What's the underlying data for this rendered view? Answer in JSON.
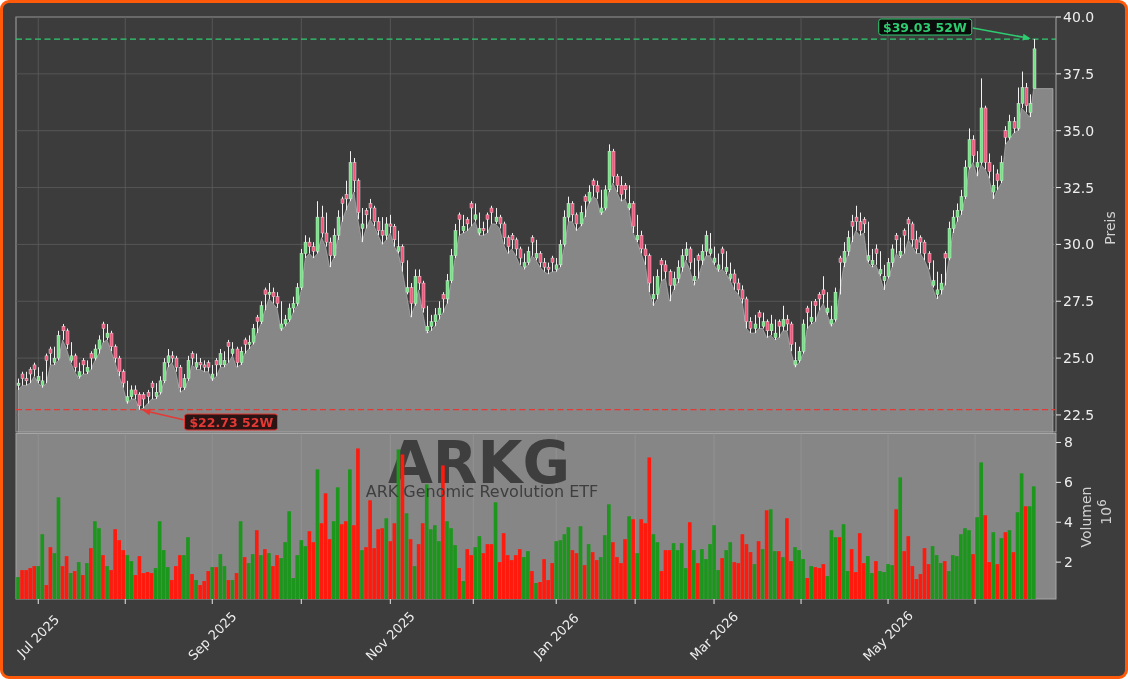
{
  "price_chart": {
    "chart_data": {
      "type": "candlestick",
      "ylabel": "Preis",
      "grid": true,
      "ylim": [
        21.75,
        40.0
      ],
      "yticks": [
        22.5,
        {
          "value": 25,
          "label": "25.0"
        },
        27.5,
        {
          "value": 30,
          "label": "30.0"
        },
        32.5,
        {
          "value": 35,
          "label": "35.0"
        },
        37.5,
        {
          "value": 40,
          "label": "40.0"
        }
      ],
      "categories": [
        null,
        null,
        null,
        null,
        null,
        null,
        null,
        null,
        null,
        null,
        null,
        null,
        null,
        null,
        null,
        null,
        null,
        null,
        null,
        null,
        null,
        null,
        null,
        null,
        null,
        null,
        null,
        null,
        null,
        null,
        null,
        null,
        null,
        null,
        null,
        null,
        null,
        null,
        null,
        null,
        null,
        null,
        null,
        null,
        null,
        null,
        null,
        null,
        null,
        null,
        null,
        null,
        null,
        null,
        null,
        null,
        null,
        null,
        null,
        null,
        null,
        null,
        null,
        null,
        null,
        null,
        null,
        null,
        null,
        null,
        null,
        null,
        null,
        null,
        null,
        null,
        null,
        null,
        null,
        null,
        null,
        null,
        null,
        null,
        null,
        null,
        null,
        null,
        null,
        null,
        null,
        null,
        null,
        null,
        null,
        null,
        null,
        null,
        null,
        null,
        null,
        null,
        null,
        null,
        null,
        null,
        null,
        null,
        null,
        null,
        null,
        null,
        null,
        null,
        null,
        null,
        null,
        null,
        null,
        null,
        null,
        null,
        null,
        null,
        null,
        null,
        null,
        null,
        null,
        null,
        null,
        null,
        null,
        null,
        null,
        null,
        null,
        null,
        null,
        null,
        null,
        null,
        null,
        null,
        null,
        null,
        null,
        null,
        null,
        null,
        null,
        null,
        null,
        null,
        null,
        null,
        null,
        null,
        null,
        null,
        null,
        null,
        null,
        null,
        null,
        null,
        null,
        null,
        null,
        null,
        null,
        null,
        null,
        null,
        null,
        null,
        null,
        null,
        null,
        null,
        null,
        null,
        null,
        null,
        null,
        null,
        null,
        null,
        null,
        null,
        null,
        null,
        null,
        null,
        null,
        null,
        null,
        null,
        null,
        null,
        null,
        null,
        null,
        null,
        null,
        null,
        null,
        null,
        null,
        null,
        null,
        null,
        null,
        null,
        null,
        null,
        null,
        null,
        null,
        null,
        null,
        null,
        null,
        null,
        null,
        null,
        null,
        null,
        null,
        null,
        null,
        null,
        null,
        null,
        null,
        null,
        null,
        null,
        null,
        null,
        null,
        null,
        null,
        null,
        null,
        null,
        null,
        null,
        null,
        null,
        null,
        null,
        null,
        null,
        null,
        null,
        null
      ],
      "ohlc": [
        [
          23.8,
          24.1,
          23.6,
          23.9
        ],
        [
          24.3,
          24.4,
          23.8,
          24.1
        ],
        [
          24.1,
          24.4,
          23.8,
          24.0
        ],
        [
          24.5,
          24.6,
          23.9,
          24.3
        ],
        [
          24.7,
          24.8,
          24.2,
          24.5
        ],
        [
          24.0,
          24.6,
          23.9,
          24.2
        ],
        [
          23.8,
          24.4,
          23.7,
          24.0
        ],
        [
          25.1,
          25.2,
          23.9,
          24.9
        ],
        [
          25.4,
          25.5,
          24.7,
          25.2
        ],
        [
          24.8,
          25.5,
          24.7,
          25.0
        ],
        [
          25.0,
          26.2,
          24.9,
          26.0
        ],
        [
          26.4,
          26.5,
          25.8,
          26.2
        ],
        [
          26.2,
          26.3,
          25.4,
          25.6
        ],
        [
          24.9,
          25.7,
          24.8,
          25.1
        ],
        [
          25.1,
          25.2,
          24.4,
          24.6
        ],
        [
          24.2,
          24.8,
          24.1,
          24.4
        ],
        [
          24.9,
          25.0,
          24.3,
          24.7
        ],
        [
          24.4,
          24.9,
          24.3,
          24.6
        ],
        [
          25.2,
          25.3,
          24.5,
          25.0
        ],
        [
          25.0,
          25.6,
          24.9,
          25.4
        ],
        [
          25.4,
          26.0,
          25.2,
          25.8
        ],
        [
          26.5,
          26.6,
          25.7,
          26.3
        ],
        [
          25.9,
          26.5,
          25.8,
          26.1
        ],
        [
          26.1,
          26.2,
          25.3,
          25.5
        ],
        [
          25.5,
          25.6,
          24.8,
          25.0
        ],
        [
          25.0,
          25.1,
          24.2,
          24.4
        ],
        [
          24.4,
          24.5,
          23.7,
          23.9
        ],
        [
          23.1,
          24.0,
          23.0,
          23.3
        ],
        [
          23.3,
          23.8,
          23.2,
          23.6
        ],
        [
          23.6,
          23.8,
          23.2,
          23.4
        ],
        [
          23.4,
          23.5,
          22.73,
          22.9
        ],
        [
          23.4,
          23.5,
          22.8,
          23.2
        ],
        [
          23.5,
          23.6,
          23.0,
          23.3
        ],
        [
          23.9,
          24.0,
          23.2,
          23.7
        ],
        [
          23.3,
          23.9,
          23.2,
          23.5
        ],
        [
          23.5,
          24.2,
          23.4,
          24.0
        ],
        [
          24.0,
          25.0,
          23.9,
          24.8
        ],
        [
          24.8,
          25.4,
          24.6,
          25.1
        ],
        [
          25.1,
          25.3,
          24.8,
          25.0
        ],
        [
          25.0,
          25.1,
          24.4,
          24.6
        ],
        [
          24.6,
          24.7,
          23.5,
          23.7
        ],
        [
          23.7,
          24.3,
          23.6,
          24.1
        ],
        [
          24.1,
          25.1,
          24.0,
          24.9
        ],
        [
          25.2,
          25.3,
          24.7,
          25.0
        ],
        [
          24.6,
          25.2,
          24.5,
          24.8
        ],
        [
          24.8,
          25.0,
          24.5,
          24.7
        ],
        [
          24.7,
          24.9,
          24.4,
          24.6
        ],
        [
          24.8,
          24.9,
          24.4,
          24.6
        ],
        [
          24.1,
          24.7,
          24.0,
          24.3
        ],
        [
          24.9,
          25.0,
          24.2,
          24.7
        ],
        [
          24.7,
          25.4,
          24.6,
          25.2
        ],
        [
          24.7,
          25.3,
          24.6,
          24.9
        ],
        [
          25.7,
          25.8,
          24.8,
          25.5
        ],
        [
          25.2,
          25.7,
          25.1,
          25.4
        ],
        [
          25.4,
          25.5,
          24.6,
          24.8
        ],
        [
          24.8,
          25.5,
          24.7,
          25.3
        ],
        [
          25.8,
          25.9,
          25.2,
          25.6
        ],
        [
          25.6,
          26.0,
          25.4,
          25.7
        ],
        [
          25.7,
          26.5,
          25.6,
          26.3
        ],
        [
          26.8,
          26.9,
          26.1,
          26.6
        ],
        [
          26.6,
          27.5,
          26.5,
          27.3
        ],
        [
          28.0,
          28.1,
          27.1,
          27.8
        ],
        [
          27.8,
          28.3,
          27.6,
          27.9
        ],
        [
          27.9,
          28.1,
          27.4,
          27.7
        ],
        [
          27.7,
          27.9,
          27.2,
          27.4
        ],
        [
          26.3,
          27.5,
          26.2,
          26.5
        ],
        [
          26.5,
          26.9,
          26.4,
          26.7
        ],
        [
          26.7,
          27.4,
          26.6,
          27.2
        ],
        [
          27.2,
          27.7,
          27.0,
          27.4
        ],
        [
          27.4,
          28.3,
          27.3,
          28.1
        ],
        [
          28.1,
          29.8,
          28.0,
          29.6
        ],
        [
          29.6,
          30.4,
          29.4,
          30.1
        ],
        [
          30.1,
          30.3,
          29.6,
          29.9
        ],
        [
          29.9,
          30.1,
          29.4,
          29.7
        ],
        [
          29.7,
          31.9,
          29.6,
          31.2
        ],
        [
          31.2,
          31.7,
          30.3,
          30.5
        ],
        [
          30.5,
          31.4,
          29.9,
          30.1
        ],
        [
          30.1,
          30.3,
          29.0,
          29.5
        ],
        [
          29.5,
          30.7,
          29.4,
          30.4
        ],
        [
          30.4,
          31.5,
          30.2,
          31.2
        ],
        [
          32.0,
          32.1,
          31.0,
          31.8
        ],
        [
          32.2,
          32.8,
          31.5,
          32.0
        ],
        [
          32.0,
          34.1,
          31.9,
          33.6
        ],
        [
          33.6,
          33.8,
          32.3,
          32.8
        ],
        [
          32.8,
          32.9,
          31.1,
          31.4
        ],
        [
          30.7,
          31.6,
          30.1,
          30.9
        ],
        [
          31.5,
          31.6,
          30.7,
          31.3
        ],
        [
          31.8,
          32.0,
          31.1,
          31.6
        ],
        [
          31.6,
          31.7,
          30.8,
          31.0
        ],
        [
          31.0,
          31.2,
          30.4,
          30.6
        ],
        [
          30.6,
          31.2,
          30.0,
          30.4
        ],
        [
          30.4,
          31.2,
          30.2,
          30.9
        ],
        [
          30.9,
          31.3,
          30.5,
          30.8
        ],
        [
          30.8,
          30.9,
          29.9,
          30.2
        ],
        [
          29.7,
          30.6,
          29.6,
          29.9
        ],
        [
          29.9,
          30.0,
          28.8,
          29.2
        ],
        [
          27.9,
          29.3,
          27.8,
          28.1
        ],
        [
          28.1,
          28.3,
          26.8,
          27.4
        ],
        [
          27.4,
          28.9,
          27.3,
          28.6
        ],
        [
          28.6,
          28.9,
          28.0,
          28.3
        ],
        [
          28.3,
          28.4,
          27.0,
          27.2
        ],
        [
          26.2,
          27.3,
          26.1,
          26.4
        ],
        [
          26.4,
          26.9,
          26.2,
          26.6
        ],
        [
          26.6,
          27.2,
          26.4,
          26.9
        ],
        [
          26.9,
          27.5,
          26.7,
          27.2
        ],
        [
          27.8,
          27.9,
          27.0,
          27.6
        ],
        [
          27.6,
          28.7,
          27.4,
          28.4
        ],
        [
          28.4,
          29.8,
          28.3,
          29.5
        ],
        [
          29.5,
          30.9,
          29.4,
          30.6
        ],
        [
          31.3,
          31.4,
          30.4,
          31.1
        ],
        [
          30.6,
          31.3,
          30.5,
          30.8
        ],
        [
          31.1,
          31.2,
          30.6,
          30.9
        ],
        [
          31.8,
          31.9,
          30.8,
          31.6
        ],
        [
          31.1,
          31.8,
          31.0,
          31.3
        ],
        [
          30.5,
          31.4,
          30.4,
          30.7
        ],
        [
          30.7,
          31.0,
          30.4,
          30.6
        ],
        [
          31.3,
          31.4,
          30.5,
          31.1
        ],
        [
          31.6,
          31.7,
          30.9,
          31.4
        ],
        [
          31.0,
          31.6,
          30.9,
          31.2
        ],
        [
          31.2,
          31.3,
          30.7,
          30.9
        ],
        [
          30.9,
          31.0,
          30.0,
          30.3
        ],
        [
          30.3,
          30.4,
          29.6,
          29.9
        ],
        [
          30.4,
          30.5,
          29.8,
          30.2
        ],
        [
          30.2,
          30.3,
          29.5,
          29.8
        ],
        [
          29.8,
          29.9,
          29.1,
          29.4
        ],
        [
          29.0,
          29.6,
          28.9,
          29.2
        ],
        [
          29.2,
          29.9,
          29.1,
          29.7
        ],
        [
          30.3,
          30.4,
          29.5,
          30.1
        ],
        [
          29.4,
          30.2,
          29.3,
          29.6
        ],
        [
          29.6,
          29.7,
          29.0,
          29.2
        ],
        [
          29.2,
          29.4,
          28.8,
          29.0
        ],
        [
          29.0,
          29.2,
          28.7,
          28.9
        ],
        [
          29.4,
          29.5,
          28.8,
          29.2
        ],
        [
          28.9,
          29.4,
          28.8,
          29.1
        ],
        [
          29.1,
          30.2,
          29.0,
          30.0
        ],
        [
          30.0,
          31.5,
          29.9,
          31.2
        ],
        [
          31.2,
          32.1,
          31.0,
          31.8
        ],
        [
          31.8,
          31.9,
          31.0,
          31.3
        ],
        [
          31.3,
          31.4,
          30.6,
          30.9
        ],
        [
          30.9,
          31.7,
          30.8,
          31.4
        ],
        [
          32.1,
          32.2,
          31.2,
          31.9
        ],
        [
          31.9,
          32.6,
          31.8,
          32.3
        ],
        [
          32.8,
          32.9,
          32.1,
          32.6
        ],
        [
          32.6,
          32.8,
          32.0,
          32.3
        ],
        [
          31.4,
          32.4,
          31.3,
          31.6
        ],
        [
          31.6,
          32.6,
          31.5,
          32.4
        ],
        [
          32.4,
          34.4,
          32.3,
          34.1
        ],
        [
          34.1,
          34.2,
          32.7,
          33.0
        ],
        [
          33.0,
          33.1,
          32.3,
          32.6
        ],
        [
          32.6,
          33.0,
          31.9,
          32.2
        ],
        [
          32.6,
          32.7,
          32.0,
          32.4
        ],
        [
          31.6,
          32.6,
          31.5,
          31.8
        ],
        [
          31.8,
          31.9,
          30.5,
          30.8
        ],
        [
          30.2,
          31.3,
          30.1,
          30.4
        ],
        [
          30.4,
          30.6,
          29.6,
          29.8
        ],
        [
          29.8,
          30.0,
          29.1,
          29.5
        ],
        [
          29.5,
          29.6,
          27.9,
          28.3
        ],
        [
          27.6,
          28.6,
          27.3,
          27.8
        ],
        [
          27.8,
          28.9,
          27.6,
          28.6
        ],
        [
          29.3,
          29.4,
          28.4,
          29.1
        ],
        [
          29.1,
          29.3,
          28.5,
          28.8
        ],
        [
          28.8,
          28.9,
          27.5,
          28.2
        ],
        [
          28.2,
          28.8,
          28.0,
          28.5
        ],
        [
          28.5,
          29.3,
          28.3,
          29.0
        ],
        [
          29.0,
          29.8,
          28.8,
          29.5
        ],
        [
          29.5,
          30.1,
          29.3,
          29.8
        ],
        [
          29.8,
          29.9,
          28.9,
          29.2
        ],
        [
          28.4,
          29.4,
          28.2,
          28.6
        ],
        [
          29.5,
          29.6,
          28.5,
          29.3
        ],
        [
          29.3,
          30.0,
          29.1,
          29.7
        ],
        [
          29.7,
          30.6,
          29.5,
          30.4
        ],
        [
          29.6,
          30.5,
          29.5,
          29.8
        ],
        [
          29.2,
          29.9,
          29.1,
          29.4
        ],
        [
          28.9,
          29.6,
          28.8,
          29.1
        ],
        [
          29.8,
          29.9,
          28.9,
          29.6
        ],
        [
          28.8,
          29.7,
          28.7,
          29.0
        ],
        [
          28.5,
          29.2,
          28.4,
          28.7
        ],
        [
          28.7,
          28.9,
          28.0,
          28.3
        ],
        [
          28.3,
          28.5,
          27.8,
          28.0
        ],
        [
          28.0,
          28.2,
          27.4,
          27.6
        ],
        [
          27.6,
          27.7,
          26.3,
          26.6
        ],
        [
          26.6,
          26.8,
          26.1,
          26.3
        ],
        [
          26.3,
          26.9,
          26.1,
          26.5
        ],
        [
          27.0,
          27.1,
          26.3,
          26.8
        ],
        [
          26.4,
          27.0,
          26.3,
          26.6
        ],
        [
          26.6,
          26.7,
          25.9,
          26.2
        ],
        [
          26.2,
          26.9,
          26.0,
          26.5
        ],
        [
          25.9,
          26.7,
          25.8,
          26.1
        ],
        [
          26.6,
          26.7,
          25.9,
          26.4
        ],
        [
          26.4,
          27.3,
          26.2,
          26.7
        ],
        [
          26.7,
          26.9,
          26.2,
          26.5
        ],
        [
          26.5,
          26.6,
          25.3,
          25.6
        ],
        [
          24.7,
          25.7,
          24.6,
          24.9
        ],
        [
          24.9,
          25.5,
          24.8,
          25.3
        ],
        [
          25.3,
          26.7,
          25.2,
          26.5
        ],
        [
          27.2,
          27.3,
          26.3,
          27.0
        ],
        [
          26.6,
          27.5,
          26.5,
          26.8
        ],
        [
          27.5,
          27.6,
          26.6,
          27.3
        ],
        [
          27.8,
          27.9,
          27.1,
          27.6
        ],
        [
          28.0,
          28.6,
          27.4,
          27.8
        ],
        [
          27.0,
          27.9,
          26.9,
          27.2
        ],
        [
          26.5,
          27.3,
          26.4,
          26.7
        ],
        [
          26.7,
          28.1,
          26.6,
          27.9
        ],
        [
          29.4,
          29.5,
          27.8,
          29.2
        ],
        [
          29.2,
          30.1,
          29.0,
          29.7
        ],
        [
          29.7,
          30.6,
          29.5,
          30.3
        ],
        [
          31.0,
          31.3,
          30.1,
          30.8
        ],
        [
          31.2,
          31.7,
          30.6,
          31.0
        ],
        [
          31.0,
          31.4,
          30.4,
          30.6
        ],
        [
          31.1,
          31.2,
          30.5,
          30.9
        ],
        [
          29.3,
          31.0,
          29.2,
          29.5
        ],
        [
          29.1,
          29.8,
          29.0,
          29.3
        ],
        [
          29.8,
          30.0,
          29.1,
          29.6
        ],
        [
          28.7,
          29.7,
          28.6,
          28.9
        ],
        [
          28.4,
          29.1,
          28.0,
          28.6
        ],
        [
          28.6,
          29.4,
          28.5,
          29.2
        ],
        [
          29.2,
          30.0,
          29.0,
          29.8
        ],
        [
          30.4,
          30.5,
          29.6,
          30.2
        ],
        [
          29.5,
          30.3,
          29.4,
          29.7
        ],
        [
          30.6,
          30.7,
          29.6,
          30.4
        ],
        [
          31.1,
          31.2,
          30.2,
          30.9
        ],
        [
          30.9,
          31.0,
          29.9,
          30.2
        ],
        [
          30.2,
          30.6,
          29.6,
          29.8
        ],
        [
          30.3,
          30.4,
          29.6,
          30.1
        ],
        [
          30.1,
          30.2,
          29.3,
          29.6
        ],
        [
          29.6,
          29.7,
          28.9,
          29.2
        ],
        [
          28.2,
          29.3,
          28.1,
          28.4
        ],
        [
          27.8,
          28.8,
          27.6,
          28.0
        ],
        [
          28.0,
          28.7,
          27.8,
          28.3
        ],
        [
          29.6,
          29.7,
          28.2,
          29.4
        ],
        [
          29.4,
          31.0,
          29.3,
          30.7
        ],
        [
          30.7,
          31.5,
          30.5,
          31.2
        ],
        [
          31.2,
          31.8,
          31.0,
          31.5
        ],
        [
          31.5,
          32.4,
          31.3,
          32.1
        ],
        [
          32.1,
          33.7,
          32.0,
          33.4
        ],
        [
          33.4,
          35.1,
          33.3,
          34.6
        ],
        [
          34.6,
          34.8,
          33.6,
          33.9
        ],
        [
          33.4,
          34.1,
          33.0,
          33.6
        ],
        [
          33.6,
          37.3,
          33.5,
          36.0
        ],
        [
          36.0,
          36.1,
          33.3,
          33.6
        ],
        [
          33.6,
          34.0,
          32.9,
          33.2
        ],
        [
          32.3,
          33.5,
          32.0,
          32.6
        ],
        [
          33.1,
          33.3,
          32.4,
          32.8
        ],
        [
          32.8,
          33.9,
          32.7,
          33.6
        ],
        [
          35.0,
          35.2,
          34.4,
          34.7
        ],
        [
          34.7,
          35.7,
          34.6,
          35.4
        ],
        [
          35.4,
          35.6,
          34.9,
          35.1
        ],
        [
          35.1,
          36.9,
          35.0,
          36.2
        ],
        [
          36.2,
          37.6,
          36.0,
          36.9
        ],
        [
          36.9,
          37.1,
          35.8,
          36.1
        ],
        [
          35.8,
          36.6,
          35.6,
          36.2
        ],
        [
          36.85,
          39.03,
          36.85,
          38.6
        ],
        null,
        null,
        null,
        null,
        null
      ],
      "ref_lines": [
        {
          "axis": "y",
          "value": 39.03,
          "color": "#2ecc71"
        },
        {
          "axis": "y",
          "value": 22.73,
          "color": "#e53935"
        }
      ],
      "annotations": [
        "$39.03 52W",
        "$22.73 52W"
      ]
    }
  },
  "fund": {
    "ticker": "ARKG",
    "name": "ARK Genomic Revolution ETF"
  },
  "volume_chart": {
    "scale_label": "10$^{6}$",
    "chart_data": {
      "type": "bar",
      "ylabel": "Volumen",
      "grid": true,
      "ylim": [
        0.15,
        8.45
      ],
      "yticks": [
        2,
        4,
        6,
        8
      ],
      "categories": [
        null,
        null,
        null,
        null,
        null,
        "Jul 2025",
        null,
        null,
        null,
        null,
        null,
        null,
        null,
        null,
        null,
        null,
        null,
        null,
        null,
        null,
        null,
        null,
        null,
        null,
        null,
        null,
        null,
        null,
        null,
        null,
        null,
        null,
        null,
        null,
        null,
        null,
        null,
        null,
        null,
        null,
        null,
        null,
        null,
        null,
        null,
        null,
        null,
        null,
        "Sep 2025",
        null,
        null,
        null,
        null,
        null,
        null,
        null,
        null,
        null,
        null,
        null,
        null,
        null,
        null,
        null,
        null,
        null,
        null,
        null,
        null,
        null,
        null,
        null,
        null,
        null,
        null,
        null,
        null,
        null,
        null,
        null,
        null,
        null,
        null,
        null,
        null,
        null,
        null,
        null,
        null,
        null,
        null,
        null,
        "Nov 2025",
        null,
        null,
        null,
        null,
        null,
        null,
        null,
        null,
        null,
        null,
        null,
        null,
        null,
        null,
        null,
        null,
        null,
        null,
        null,
        null,
        null,
        null,
        null,
        null,
        null,
        null,
        null,
        null,
        null,
        null,
        null,
        null,
        null,
        null,
        null,
        null,
        null,
        null,
        null,
        null,
        "Jan 2026",
        null,
        null,
        null,
        null,
        null,
        null,
        null,
        null,
        null,
        null,
        null,
        null,
        null,
        null,
        null,
        null,
        null,
        null,
        null,
        null,
        null,
        null,
        null,
        null,
        null,
        null,
        null,
        null,
        null,
        null,
        null,
        null,
        null,
        null,
        null,
        null,
        null,
        null,
        "Mar 2026",
        null,
        null,
        null,
        null,
        null,
        null,
        null,
        null,
        null,
        null,
        null,
        null,
        null,
        null,
        null,
        null,
        null,
        null,
        null,
        null,
        null,
        null,
        null,
        null,
        null,
        null,
        null,
        null,
        null,
        null,
        null,
        null,
        null,
        null,
        null,
        null,
        null,
        null,
        null,
        null,
        null,
        null,
        "May 2026",
        null,
        null,
        null,
        null,
        null,
        null,
        null,
        null,
        null,
        null,
        null,
        null,
        null,
        null,
        null,
        null,
        null,
        null,
        null,
        null,
        null,
        null,
        null,
        null,
        null,
        null,
        null,
        null,
        null,
        null,
        null,
        null,
        null,
        null,
        null,
        null,
        null,
        null,
        null,
        null,
        null
      ],
      "values": [
        1.25,
        1.6,
        1.6,
        1.7,
        1.8,
        1.8,
        3.4,
        0.85,
        2.75,
        2.45,
        5.25,
        1.8,
        2.3,
        1.45,
        1.55,
        2.0,
        1.35,
        1.95,
        2.7,
        4.05,
        3.7,
        2.35,
        1.8,
        1.6,
        3.65,
        3.1,
        2.6,
        2.35,
        2.05,
        1.35,
        2.3,
        1.45,
        1.5,
        1.45,
        1.7,
        4.05,
        2.6,
        1.75,
        1.1,
        1.8,
        2.35,
        2.35,
        3.25,
        1.4,
        1.1,
        0.85,
        1.05,
        1.55,
        1.75,
        1.75,
        2.4,
        1.8,
        1.1,
        1.1,
        1.45,
        4.05,
        2.25,
        1.95,
        2.4,
        3.6,
        2.35,
        2.65,
        2.45,
        1.8,
        2.35,
        2.2,
        3.0,
        4.55,
        1.2,
        2.35,
        3.1,
        2.8,
        3.55,
        3.0,
        6.65,
        3.95,
        5.45,
        3.15,
        4.05,
        5.75,
        3.9,
        4.05,
        6.65,
        3.85,
        7.7,
        2.6,
        2.75,
        5.1,
        2.7,
        3.65,
        3.7,
        4.2,
        3.05,
        3.95,
        7.65,
        7.4,
        4.45,
        3.15,
        1.8,
        2.9,
        3.95,
        5.9,
        3.65,
        3.85,
        3.05,
        6.85,
        4.05,
        3.7,
        2.85,
        1.7,
        1.05,
        2.65,
        2.35,
        2.75,
        3.3,
        2.45,
        2.9,
        2.9,
        5.0,
        2.0,
        3.45,
        2.35,
        2.1,
        2.35,
        2.65,
        2.25,
        2.55,
        1.55,
        0.95,
        1.0,
        2.15,
        1.1,
        1.95,
        3.05,
        3.1,
        3.4,
        3.75,
        2.6,
        2.45,
        3.8,
        1.85,
        2.9,
        2.5,
        2.1,
        2.25,
        3.35,
        4.9,
        3.0,
        2.25,
        1.95,
        3.15,
        4.3,
        4.15,
        2.45,
        4.15,
        3.95,
        7.25,
        3.4,
        3.0,
        1.55,
        2.6,
        2.6,
        2.95,
        2.6,
        2.95,
        1.7,
        4.0,
        2.6,
        1.95,
        2.65,
        2.15,
        2.9,
        3.85,
        1.6,
        2.2,
        2.6,
        3.0,
        2.0,
        1.95,
        3.4,
        2.9,
        2.5,
        1.9,
        3.05,
        2.65,
        4.6,
        4.65,
        2.55,
        2.55,
        2.25,
        4.2,
        2.05,
        2.75,
        2.6,
        2.15,
        1.2,
        1.8,
        1.75,
        1.7,
        1.9,
        1.3,
        3.6,
        3.25,
        3.25,
        3.9,
        1.55,
        2.65,
        1.5,
        3.45,
        1.95,
        2.3,
        1.45,
        2.05,
        1.55,
        1.5,
        1.9,
        1.85,
        4.65,
        6.25,
        2.55,
        3.3,
        1.8,
        1.15,
        1.4,
        2.7,
        1.9,
        2.8,
        2.35,
        1.95,
        2.05,
        1.55,
        2.35,
        2.3,
        3.4,
        3.7,
        3.6,
        2.4,
        4.25,
        7.0,
        4.35,
        2.0,
        3.5,
        1.9,
        3.2,
        3.5,
        3.6,
        2.5,
        4.5,
        6.45,
        4.8,
        4.8,
        5.8,
        null,
        null,
        null,
        null,
        null
      ]
    }
  }
}
